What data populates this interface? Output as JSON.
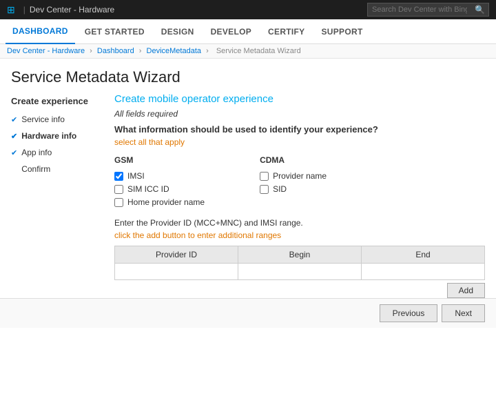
{
  "topbar": {
    "logo": "⊞",
    "separator": "|",
    "title": "Dev Center - Hardware",
    "search_placeholder": "Search Dev Center with Bing"
  },
  "navbar": {
    "items": [
      {
        "label": "DASHBOARD",
        "active": true
      },
      {
        "label": "GET STARTED",
        "active": false
      },
      {
        "label": "DESIGN",
        "active": false
      },
      {
        "label": "DEVELOP",
        "active": false
      },
      {
        "label": "CERTIFY",
        "active": false
      },
      {
        "label": "SUPPORT",
        "active": false
      }
    ]
  },
  "breadcrumb": {
    "items": [
      "Dev Center - Hardware",
      "Dashboard",
      "DeviceMetadata",
      "Service Metadata Wizard"
    ]
  },
  "page_title": "Service Metadata Wizard",
  "sidebar": {
    "heading": "Create experience",
    "items": [
      {
        "label": "Service info",
        "checked": true,
        "active": false
      },
      {
        "label": "Hardware info",
        "checked": true,
        "active": true
      },
      {
        "label": "App info",
        "checked": true,
        "active": false
      },
      {
        "label": "Confirm",
        "checked": false,
        "active": false
      }
    ]
  },
  "main": {
    "heading": "Create mobile operator experience",
    "required_text": "All fields required",
    "question": "What information should be used to identify your experience?",
    "select_all_link": "select all that apply",
    "gsm_label": "GSM",
    "cdma_label": "CDMA",
    "gsm_options": [
      {
        "label": "IMSI",
        "checked": true
      },
      {
        "label": "SIM ICC ID",
        "checked": false
      },
      {
        "label": "Home provider name",
        "checked": false
      }
    ],
    "cdma_options": [
      {
        "label": "Provider name",
        "checked": false
      },
      {
        "label": "SID",
        "checked": false
      }
    ],
    "provider_info": "Enter the Provider ID (MCC+MNC) and IMSI range.",
    "add_link": "click the add button to enter additional ranges",
    "table": {
      "columns": [
        "Provider ID",
        "Begin",
        "End"
      ],
      "rows": []
    },
    "add_button_label": "Add"
  },
  "bottom": {
    "previous_label": "Previous",
    "next_label": "Next"
  }
}
